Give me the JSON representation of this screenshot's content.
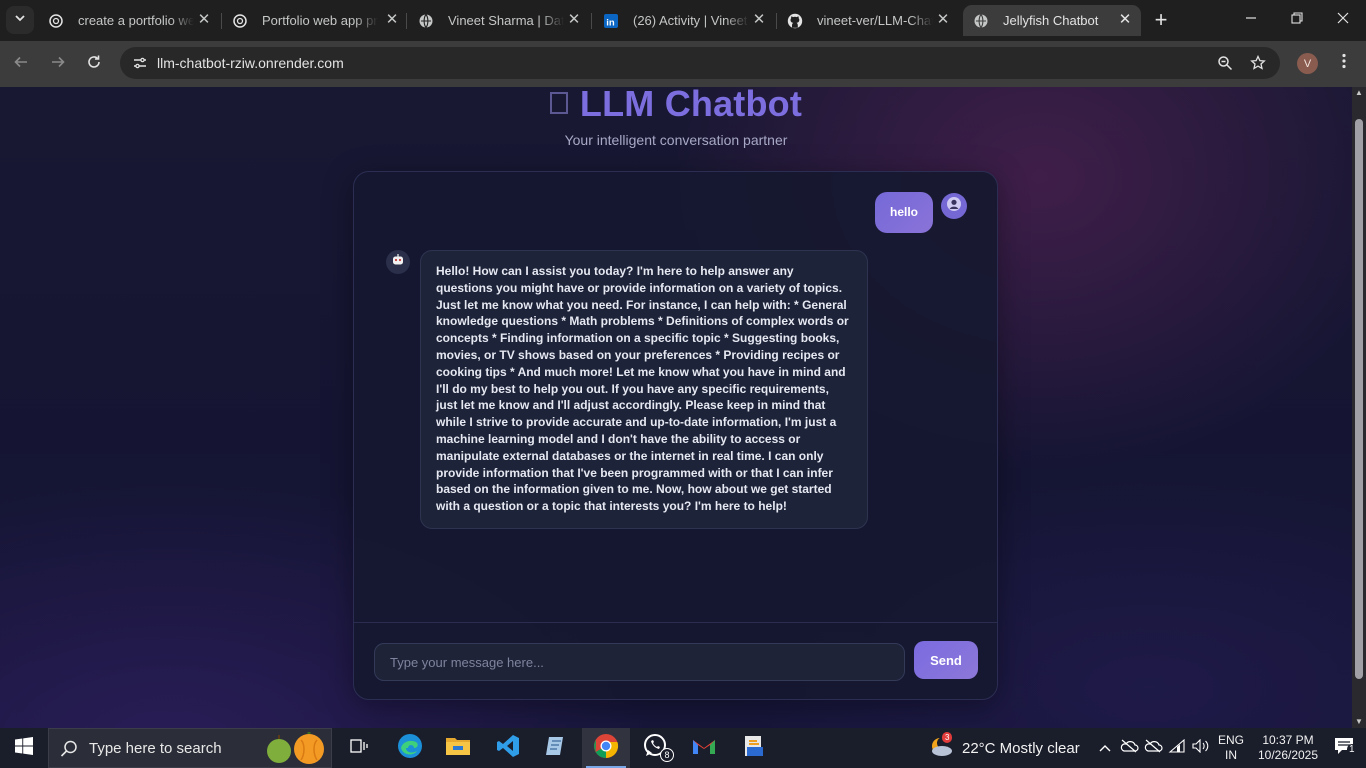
{
  "browser": {
    "tabs": [
      {
        "title": "create a portfolio web",
        "icon": "chatgpt-icon"
      },
      {
        "title": "Portfolio web app pro",
        "icon": "chatgpt-icon"
      },
      {
        "title": "Vineet Sharma | Data",
        "icon": "globe-icon"
      },
      {
        "title": "(26) Activity | Vineet",
        "icon": "linkedin-icon"
      },
      {
        "title": "vineet-ver/LLM-Chat",
        "icon": "github-icon"
      },
      {
        "title": "Jellyfish Chatbot",
        "icon": "globe-icon"
      }
    ],
    "url": "llm-chatbot-rziw.onrender.com",
    "profile_initial": "V"
  },
  "page": {
    "title": "LLM Chatbot",
    "subtitle": "Your intelligent conversation partner",
    "accent_color": "#7d6ee0"
  },
  "chat": {
    "messages": [
      {
        "role": "user",
        "text": "hello"
      },
      {
        "role": "bot",
        "text": "Hello! How can I assist you today? I'm here to help answer any questions you might have or provide information on a variety of topics. Just let me know what you need. For instance, I can help with: * General knowledge questions * Math problems * Definitions of complex words or concepts * Finding information on a specific topic * Suggesting books, movies, or TV shows based on your preferences * Providing recipes or cooking tips * And much more! Let me know what you have in mind and I'll do my best to help you out. If you have any specific requirements, just let me know and I'll adjust accordingly. Please keep in mind that while I strive to provide accurate and up-to-date information, I'm just a machine learning model and I don't have the ability to access or manipulate external databases or the internet in real time. I can only provide information that I've been programmed with or that I can infer based on the information given to me. Now, how about we get started with a question or a topic that interests you? I'm here to help!"
      }
    ],
    "input_placeholder": "Type your message here...",
    "send_label": "Send"
  },
  "taskbar": {
    "search_placeholder": "Type here to search",
    "whatsapp_badge": "8",
    "weather_badge": "3",
    "weather": "22°C  Mostly clear",
    "lang_line1": "ENG",
    "lang_line2": "IN",
    "time": "10:37 PM",
    "date": "10/26/2025",
    "notification_count": "1"
  }
}
